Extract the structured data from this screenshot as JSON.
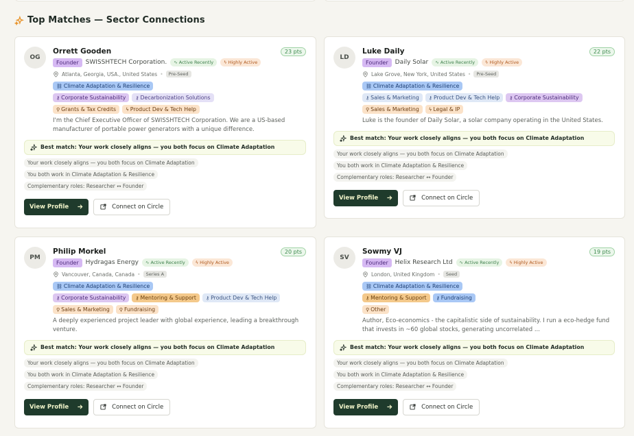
{
  "section": {
    "title": "Top Matches — Sector Connections"
  },
  "buttons": {
    "view_profile": "View Profile",
    "connect": "Connect on Circle"
  },
  "status": {
    "active": "Active Recently",
    "highly": "Highly Active"
  },
  "cards": [
    {
      "initials": "OG",
      "name": "Orrett Gooden",
      "points": "23 pts",
      "role": "Founder",
      "company": "SWISSHTECH Corporation.",
      "location": "Atlanta, Georgia, USA., United States",
      "stage": "Pre-Seed",
      "tags": [
        [
          {
            "label": "Climate Adaptation & Resilience",
            "style": "blue",
            "icon": "link-icon"
          }
        ],
        [
          {
            "label": "Corporate Sustainability",
            "style": "purple",
            "icon": "key-icon"
          },
          {
            "label": "Decarbonization Solutions",
            "style": "lav",
            "icon": "key-icon"
          }
        ],
        [
          {
            "label": "Grants & Tax Credits",
            "style": "peach",
            "icon": "search-icon"
          },
          {
            "label": "Product Dev & Tech Help",
            "style": "peach",
            "icon": "bolt-icon"
          }
        ]
      ],
      "description": "I'm the Chief Executive Officer of SWISSHTECH Corporation. We are a US-based manufacturer of portable power generators with a unique difference.",
      "best_match": "Best match: Your work closely aligns — you both focus on Climate Adaptation",
      "reasons": [
        "Your work closely aligns — you both focus on Climate Adaptation",
        "You both work in Climate Adaptation & Resilience",
        "Complementary roles: Researcher ↔ Founder"
      ]
    },
    {
      "initials": "LD",
      "name": "Luke Daily",
      "points": "22 pts",
      "role": "Founder",
      "company": "Daily Solar",
      "location": "Lake Grove, New York, United States",
      "stage": "Pre-Seed",
      "tags": [
        [
          {
            "label": "Climate Adaptation & Resilience",
            "style": "blue",
            "icon": "link-icon"
          }
        ],
        [
          {
            "label": "Sales & Marketing",
            "style": "lblue",
            "icon": "key-icon"
          },
          {
            "label": "Product Dev & Tech Help",
            "style": "lblue",
            "icon": "key-icon"
          },
          {
            "label": "Corporate Sustainability",
            "style": "purple",
            "icon": "key-icon"
          }
        ],
        [
          {
            "label": "Sales & Marketing",
            "style": "peach",
            "icon": "search-icon"
          },
          {
            "label": "Legal & IP",
            "style": "peach",
            "icon": "bolt-icon"
          }
        ]
      ],
      "description": "Luke is the founder of Daily Solar, a solar company operating in the United States.",
      "best_match": "Best match: Your work closely aligns — you both focus on Climate Adaptation",
      "reasons": [
        "Your work closely aligns — you both focus on Climate Adaptation",
        "You both work in Climate Adaptation & Resilience",
        "Complementary roles: Researcher ↔ Founder"
      ]
    },
    {
      "initials": "PM",
      "name": "Philip Morkel",
      "points": "20 pts",
      "role": "Founder",
      "company": "Hydragas Energy",
      "location": "Vancouver, Canada, Canada",
      "stage": "Series A",
      "tags": [
        [
          {
            "label": "Climate Adaptation & Resilience",
            "style": "blue",
            "icon": "link-icon"
          }
        ],
        [
          {
            "label": "Corporate Sustainability",
            "style": "purple",
            "icon": "key-icon"
          },
          {
            "label": "Mentoring & Support",
            "style": "orange",
            "icon": "key-icon"
          },
          {
            "label": "Product Dev & Tech Help",
            "style": "lblue",
            "icon": "key-icon"
          }
        ],
        [
          {
            "label": "Sales & Marketing",
            "style": "peach",
            "icon": "search-icon"
          },
          {
            "label": "Fundraising",
            "style": "peach",
            "icon": "search-icon"
          }
        ]
      ],
      "description": "A deeply experienced project leader with global experience, leading a breakthrough venture.",
      "best_match": "Best match: Your work closely aligns — you both focus on Climate Adaptation",
      "reasons": [
        "Your work closely aligns — you both focus on Climate Adaptation",
        "You both work in Climate Adaptation & Resilience",
        "Complementary roles: Researcher ↔ Founder"
      ]
    },
    {
      "initials": "SV",
      "name": "Sowmy VJ",
      "points": "19 pts",
      "role": "Founder",
      "company": "Helix Research Ltd",
      "location": "London, United Kingdom",
      "stage": "Seed",
      "tags": [
        [
          {
            "label": "Climate Adaptation & Resilience",
            "style": "blue",
            "icon": "link-icon"
          }
        ],
        [
          {
            "label": "Mentoring & Support",
            "style": "orange",
            "icon": "key-icon"
          },
          {
            "label": "Fundraising",
            "style": "blue",
            "icon": "key-icon"
          }
        ],
        [
          {
            "label": "Other",
            "style": "peach",
            "icon": "search-icon"
          }
        ]
      ],
      "description": "Author, Eco-economics - the capitalistic side of sustainability. I run a eco-hedge fund that invests in ~60 global stocks, generating uncorrelated ...",
      "best_match": "Best match: Your work closely aligns — you both focus on Climate Adaptation",
      "reasons": [
        "Your work closely aligns — you both focus on Climate Adaptation",
        "You both work in Climate Adaptation & Resilience",
        "Complementary roles: Researcher ↔ Founder"
      ]
    }
  ]
}
